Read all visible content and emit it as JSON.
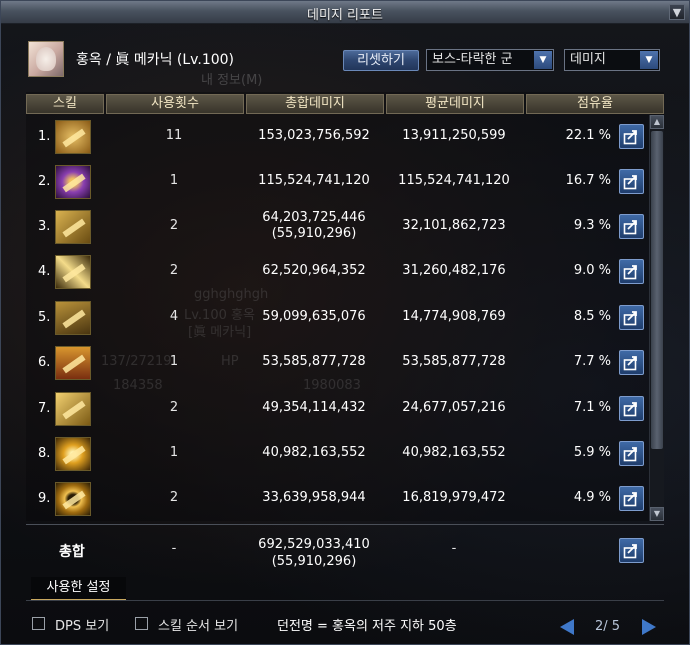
{
  "window": {
    "title": "데미지 리포트",
    "close_label": "▼"
  },
  "player": {
    "name": "홍옥 / 眞 메카닉 (Lv.100)"
  },
  "background_text": {
    "info_tab": "내 정보(M)",
    "char_id": "gghghghgh",
    "char_line": "Lv.100 홍옥",
    "char_class": "[眞 메카닉]",
    "hp_label": "HP",
    "stat_1": "184358",
    "stat_2": "1980083",
    "stat_3": "137/27219"
  },
  "controls": {
    "reset_label": "리셋하기",
    "boss_filter_value": "보스-타락한 군",
    "metric_value": "데미지"
  },
  "table": {
    "headers": [
      "스킬",
      "사용횟수",
      "총합데미지",
      "평균데미지",
      "점유율"
    ],
    "rows": [
      {
        "index": "1.",
        "icon": "mech-missile-icon",
        "uses": "11",
        "total": "153,023,756,592",
        "total_extra": "",
        "avg": "13,911,250,599",
        "pct": "22.1 %"
      },
      {
        "index": "2.",
        "icon": "purple-hexagon-icon",
        "uses": "1",
        "total": "115,524,741,120",
        "total_extra": "",
        "avg": "115,524,741,120",
        "pct": "16.7 %"
      },
      {
        "index": "3.",
        "icon": "rocket-salvo-icon",
        "uses": "2",
        "total": "64,203,725,446",
        "total_extra": "(55,910,296)",
        "avg": "32,101,862,723",
        "pct": "9.3 %"
      },
      {
        "index": "4.",
        "icon": "laser-beam-icon",
        "uses": "2",
        "total": "62,520,964,352",
        "total_extra": "",
        "avg": "31,260,482,176",
        "pct": "9.0 %"
      },
      {
        "index": "5.",
        "icon": "g3-rocket-icon",
        "uses": "4",
        "total": "59,099,635,076",
        "total_extra": "",
        "avg": "14,774,908,769",
        "pct": "8.5 %"
      },
      {
        "index": "6.",
        "icon": "robot-summon-icon",
        "uses": "1",
        "total": "53,585,877,728",
        "total_extra": "",
        "avg": "53,585,877,728",
        "pct": "7.7 %"
      },
      {
        "index": "7.",
        "icon": "cannon-barrage-icon",
        "uses": "2",
        "total": "49,354,114,432",
        "total_extra": "",
        "avg": "24,677,057,216",
        "pct": "7.1 %"
      },
      {
        "index": "8.",
        "icon": "explosion-burst-icon",
        "uses": "1",
        "total": "40,982,163,552",
        "total_extra": "",
        "avg": "40,982,163,552",
        "pct": "5.9 %"
      },
      {
        "index": "9.",
        "icon": "gear-wheel-icon",
        "uses": "2",
        "total": "33,639,958,944",
        "total_extra": "",
        "avg": "16,819,979,472",
        "pct": "4.9 %"
      }
    ]
  },
  "summary": {
    "label": "총합",
    "uses": "-",
    "total": "692,529,033,410",
    "total_extra": "(55,910,296)",
    "avg": "-"
  },
  "tab_label": "사용한 설정",
  "footer": {
    "dps_label": "DPS 보기",
    "skill_order_label": "스킬 순서 보기",
    "dungeon_text": "던전명 = 홍옥의 저주 지하 50층",
    "page": "2/ 5"
  },
  "colors": {
    "accent_blue": "#3f78c9",
    "header_gold": "#f1e5c3",
    "icon_gold": "#e0b340",
    "icon_purple": "#8a3fb0"
  }
}
